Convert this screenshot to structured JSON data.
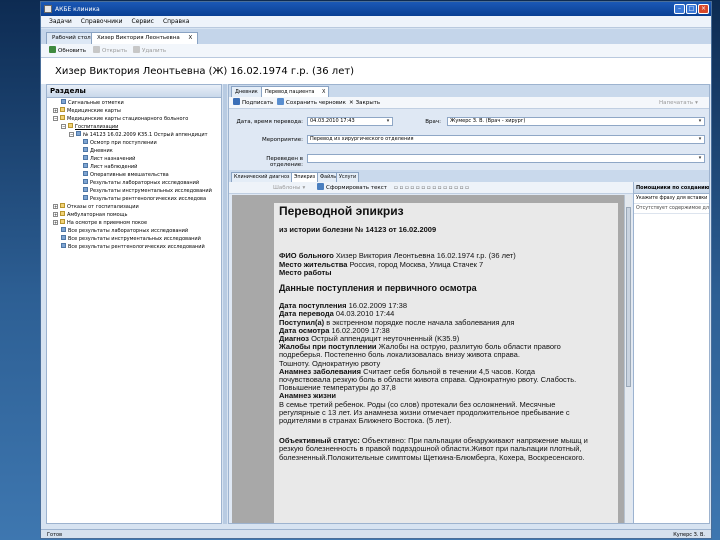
{
  "window": {
    "title": "АКБЕ клиника"
  },
  "menu": [
    "Задачи",
    "Справочники",
    "Сервис",
    "Справка"
  ],
  "doc_tabs": [
    {
      "label": "Рабочий стол"
    },
    {
      "label": "Хизер Виктория Леонтьевна",
      "close": "X"
    }
  ],
  "toolbar": {
    "refresh": "Обновить",
    "open": "Открыть",
    "delete": "Удалить"
  },
  "patient": {
    "header": "Хизер Виктория Леонтьевна (Ж) 16.02.1974 г.р. (36 лет)"
  },
  "sections": {
    "title": "Разделы",
    "items": [
      "Сигнальные отметки",
      "Медицинские карты",
      "Медицинские карты стационарного больного",
      "Госпитализации",
      "№ 14123 16.02.2009 К35.1 Острый аппендицит",
      "Осмотр при поступлении",
      "Дневник",
      "Лист назначений",
      "Лист наблюдений",
      "Оперативные вмешательства",
      "Результаты лабораторных исследований",
      "Результаты инструментальных исследований",
      "Результаты рентгенологических исследова",
      "Отказы от госпитализации",
      "Амбулаторная помощь",
      "На осмотре в приемном покое",
      "Все результаты лабораторных исследований",
      "Все результаты инструментальных исследований",
      "Все результаты рентгенологических исследований"
    ]
  },
  "right_tabs": {
    "diary": "Дневник",
    "transfer": "Перевод пациента",
    "close": "X"
  },
  "form_toolbar": {
    "sign": "Подписать",
    "save_draft": "Сохранить черновик",
    "close": "Закрыть",
    "print": "Напечатать"
  },
  "form": {
    "transfer_date_label": "Дата, время перевода:",
    "transfer_date_value": "04.03.2010 17:43",
    "doctor_label": "Врач:",
    "doctor_value": "Жумерс З. В. (Врач - хирург)",
    "event_label": "Мероприятие:",
    "event_value": "Перевод из хирургического отделения",
    "dept_label": "Переведен в отделение:",
    "dept_value": ""
  },
  "inner_tabs": [
    "Клинический диагноз",
    "Эпикриз",
    "Файлы",
    "Услуги"
  ],
  "editor": {
    "shrift": "Шаблоны",
    "format_btn": "Сформировать текст"
  },
  "document": {
    "title": "Переводной эпикриз",
    "subtitle": "из истории болезни № 14123 от 16.02.2009",
    "lines": [
      {
        "label": "ФИО больного",
        "text": " Хизер Виктория Леонтьевна 16.02.1974 г.р. (36 лет)"
      },
      {
        "label": "Место жительства",
        "text": " Россия, город Москва, Улица Стачек 7"
      },
      {
        "label": "Место работы",
        "text": ""
      }
    ],
    "section_heading": "Данные поступления и первичного осмотра",
    "lines2": [
      {
        "label": "Дата поступления",
        "text": " 16.02.2009 17:38"
      },
      {
        "label": "Дата перевода",
        "text": " 04.03.2010 17:44"
      },
      {
        "label": "Поступил(а)",
        "text": " в экстренном порядке после начала заболевания для"
      },
      {
        "label": "Дата осмотра",
        "text": " 16.02.2009 17:38"
      },
      {
        "label": "Диагноз",
        "text": " Острый аппендицит неуточненный (K35.9)"
      },
      {
        "label": "Жалобы при поступлении",
        "text": " Жалобы на острую, разлитую боль  области правого"
      },
      {
        "label": "",
        "text": "подреберья. Постепенно боль локализовалась внизу живота справа."
      },
      {
        "label": "",
        "text": "Тошноту. Однократную рвоту"
      },
      {
        "label": "Анамнез заболевания",
        "text": " Считает себя больной  в течении 4,5 часов. Когда"
      },
      {
        "label": "",
        "text": "почувствовала резкую боль в области живота справа. Однократную рвоту.  Слабость."
      },
      {
        "label": "",
        "text": "Повышение температуры до 37,8"
      },
      {
        "label": "Анамнез жизни",
        "text": ""
      },
      {
        "label": "",
        "text": "В семье третий ребенок. Роды (со слов) протекали без осложнений. Месячные"
      },
      {
        "label": "",
        "text": "регулярные с 13 лет. Из анамнеза жизни отмечает продолжительное пребывание с"
      },
      {
        "label": "",
        "text": "родителями в странах Ближнего Востока. (5 лет)."
      }
    ],
    "lines3": [
      {
        "label": "Объективный статус:",
        "text": " Объективно: При пальпации обнаруживают напряжение мышц и"
      },
      {
        "label": "",
        "text": "резкую болезненность в правой подвздошной области.Живот при пальпации плотный,"
      },
      {
        "label": "",
        "text": "болезненный.Положительные симптомы Щеткина-Блюмберга, Кохера, Воскресенского."
      }
    ]
  },
  "side_panel": {
    "title": "Помощники по созданию эпикризов",
    "row1": "Укажите фразу для вставки в текст:",
    "row2": "Отсутствует содержимое для те"
  },
  "status": {
    "left": "Готов",
    "right": "Куперс З. В."
  }
}
